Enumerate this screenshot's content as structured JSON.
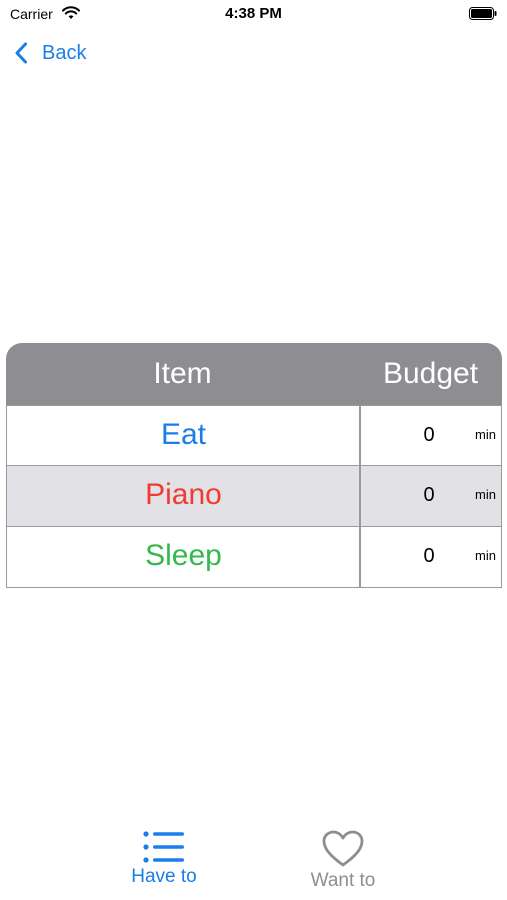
{
  "status_bar": {
    "carrier": "Carrier",
    "time": "4:38 PM"
  },
  "nav": {
    "back_label": "Back"
  },
  "table": {
    "headers": {
      "item": "Item",
      "budget": "Budget"
    },
    "rows": [
      {
        "item": "Eat",
        "value": "0",
        "unit": "min",
        "color": "#1a7ee8"
      },
      {
        "item": "Piano",
        "value": "0",
        "unit": "min",
        "color": "#ef3b32"
      },
      {
        "item": "Sleep",
        "value": "0",
        "unit": "min",
        "color": "#35b94e"
      }
    ]
  },
  "tabs": [
    {
      "label": "Have to",
      "icon": "list-icon",
      "selected": true
    },
    {
      "label": "Want to",
      "icon": "heart-icon",
      "selected": false
    }
  ],
  "colors": {
    "accent": "#1a7ee8",
    "header_bg": "#8e8e92",
    "alt_row_bg": "#e2e2e6",
    "inactive": "#8e8e92"
  }
}
